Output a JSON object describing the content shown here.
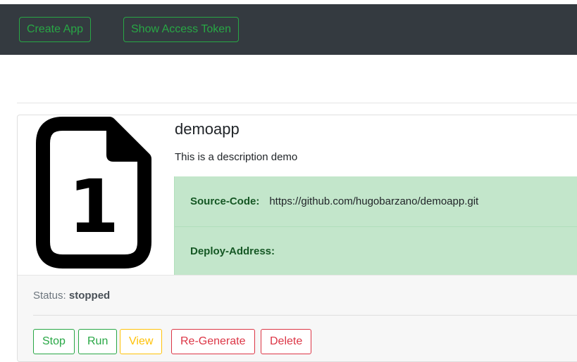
{
  "navbar": {
    "create_app_label": "Create App",
    "show_token_label": "Show Access Token"
  },
  "app": {
    "icon": "file-number-1-icon",
    "icon_number": "1",
    "name": "demoapp",
    "description": "This is a description demo",
    "source_code_label": "Source-Code:",
    "source_code_value": "https://github.com/hugobarzano/demoapp.git",
    "deploy_address_label": "Deploy-Address:",
    "deploy_address_value": "",
    "status_label": "Status:",
    "status_value": "stopped"
  },
  "actions": {
    "stop_label": "Stop",
    "run_label": "Run",
    "view_label": "View",
    "regenerate_label": "Re-Generate",
    "delete_label": "Delete"
  },
  "colors": {
    "navbar_bg": "#343a40",
    "success": "#28a745",
    "warning": "#ffc107",
    "danger": "#dc3545",
    "info_box_bg": "#c3e6cb",
    "info_label": "#155724"
  }
}
